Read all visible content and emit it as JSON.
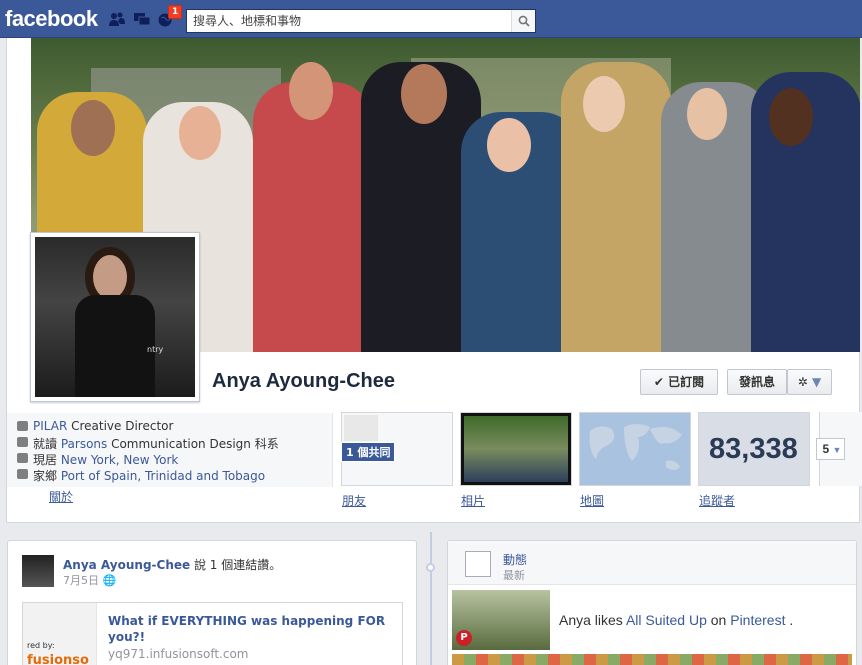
{
  "topbar": {
    "logo": "facebook",
    "notification_count": "1",
    "search_placeholder": "搜尋人、地標和事物"
  },
  "profile": {
    "name": "Anya Ayoung-Chee",
    "subscribed_label": "已訂閱",
    "message_label": "發訊息"
  },
  "info": {
    "work": {
      "link": "PILAR",
      "text": " Creative Director"
    },
    "edu": {
      "prefix": "就讀 ",
      "link": "Parsons",
      "text": " Communication Design 科系"
    },
    "lives": {
      "prefix": "現居 ",
      "link": "New York, New York"
    },
    "from": {
      "prefix": "家鄉 ",
      "link": "Port of Spain, Trinidad and Tobago"
    },
    "about_label": "關於"
  },
  "apps": {
    "friends_label": "朋友",
    "friends_mutual": "1 個共同",
    "photos_label": "相片",
    "map_label": "地圖",
    "followers_label": "追蹤者",
    "followers_count": "83,338",
    "more_count": "5"
  },
  "post": {
    "author": "Anya Ayoung-Chee",
    "action": " 說 1 個連結讚。",
    "date": "7月5日",
    "link_title": "What if EVERYTHING was happening FOR you?!",
    "link_url": "yq971.infusionsoft.com",
    "thumb_top": "red by:",
    "thumb_brand": "fusionso"
  },
  "activity": {
    "title": "動態",
    "subtitle": "最新",
    "text_prefix": "Anya likes ",
    "text_link": "All Suited Up",
    "text_mid": " on ",
    "text_link2": "Pinterest",
    "text_end": " ."
  }
}
